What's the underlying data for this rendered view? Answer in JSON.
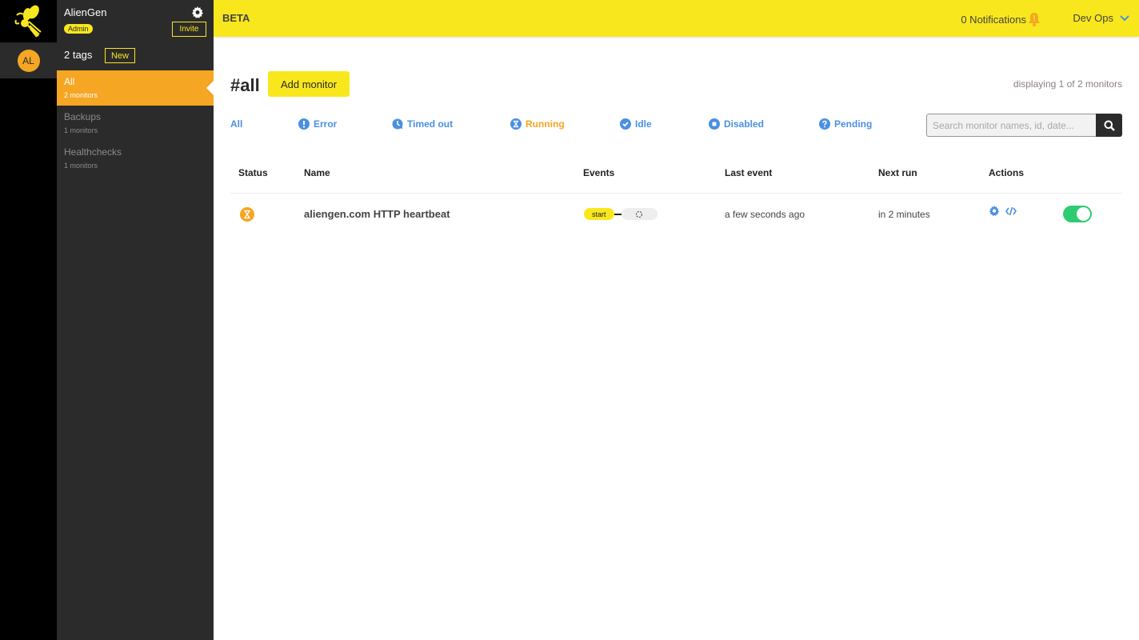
{
  "app": {
    "brand_color": "#f9e71e",
    "accent_color": "#f5a623",
    "link_color": "#4a90e2"
  },
  "rail": {
    "logo_icon": "bee-icon",
    "avatar_initials": "AL"
  },
  "sidebar": {
    "org_name": "AlienGen",
    "role_badge": "Admin",
    "invite_label": "Invite",
    "tags_count": "2 tags",
    "new_label": "New",
    "tags": [
      {
        "name": "All",
        "count": "2 monitors",
        "active": true
      },
      {
        "name": "Backups",
        "count": "1 monitors",
        "active": false
      },
      {
        "name": "Healthchecks",
        "count": "1 monitors",
        "active": false
      }
    ]
  },
  "topbar": {
    "beta_label": "BETA",
    "notifications": "0 Notifications",
    "org_switch": "Dev Ops"
  },
  "main": {
    "title": "#all",
    "add_monitor_label": "Add monitor",
    "displaying": "displaying 1 of 2 monitors",
    "filters": [
      {
        "label": "All",
        "icon": "none",
        "active": false
      },
      {
        "label": "Error",
        "icon": "exclamation-circle-icon",
        "active": false
      },
      {
        "label": "Timed out",
        "icon": "clock-icon",
        "active": false
      },
      {
        "label": "Running",
        "icon": "hourglass-icon",
        "active": true
      },
      {
        "label": "Idle",
        "icon": "check-circle-icon",
        "active": false
      },
      {
        "label": "Disabled",
        "icon": "stop-circle-icon",
        "active": false
      },
      {
        "label": "Pending",
        "icon": "question-circle-icon",
        "active": false
      }
    ],
    "search": {
      "placeholder": "Search monitor names, id, date...",
      "value": ""
    },
    "table": {
      "headers": [
        "Status",
        "Name",
        "Events",
        "Last event",
        "Next run",
        "Actions"
      ],
      "rows": [
        {
          "status": "running",
          "name": "aliengen.com HTTP heartbeat",
          "events": [
            "start",
            "pending"
          ],
          "last_event": "a few seconds ago",
          "next_run": "in 2 minutes",
          "enabled": true
        }
      ]
    }
  }
}
